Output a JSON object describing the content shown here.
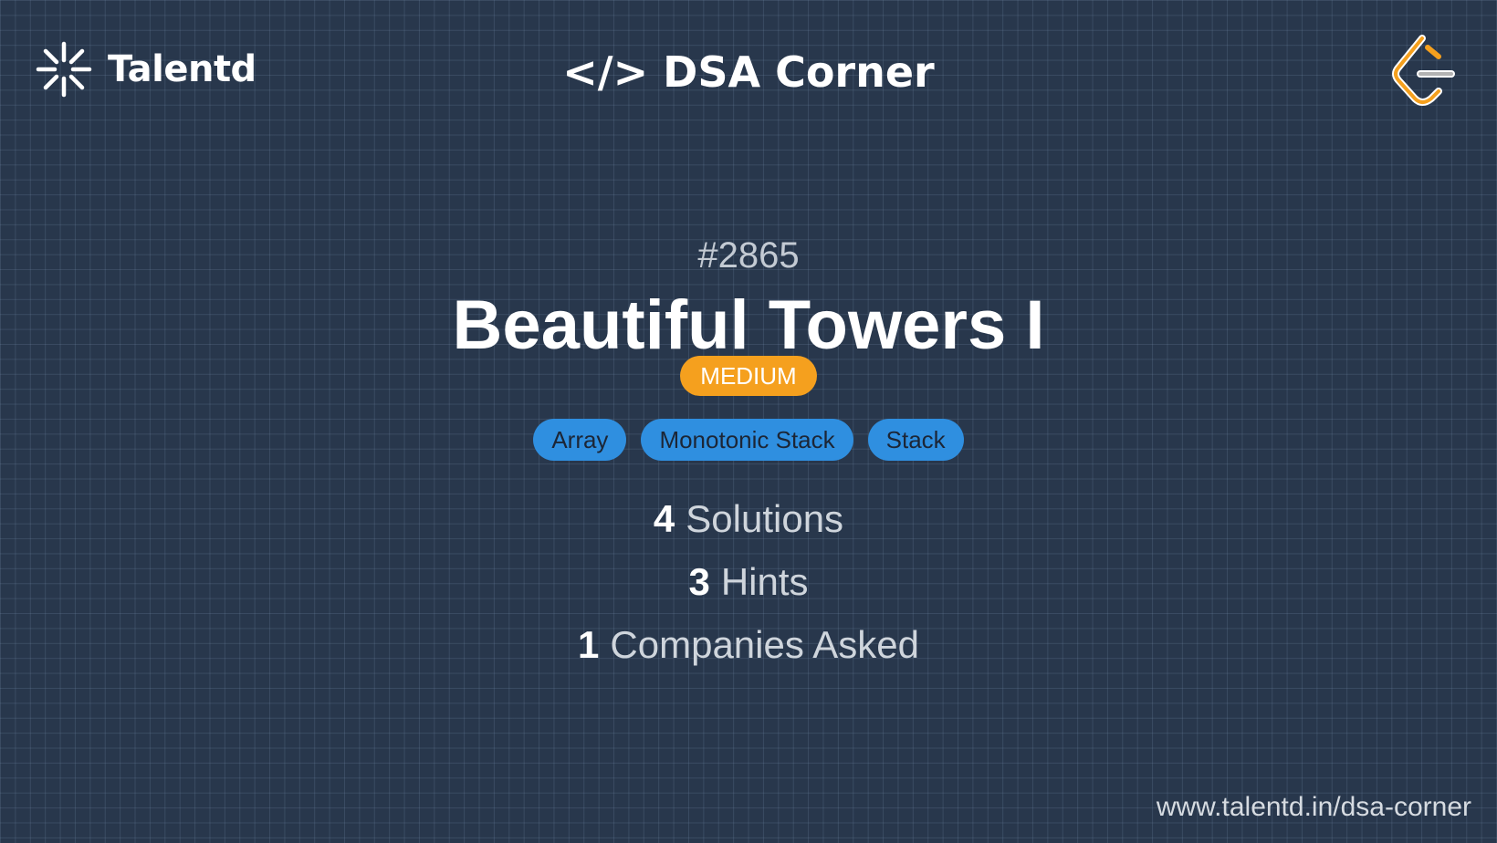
{
  "brand": {
    "name": "Talentd",
    "icon": "asterisk-burst-icon"
  },
  "header": {
    "title": "</> DSA Corner"
  },
  "corner_logo": {
    "icon": "leetcode-logo-icon",
    "colors": {
      "bracket": "#f5a01e",
      "dash": "#b3b3b3",
      "outline": "#ffffff"
    }
  },
  "problem": {
    "number": "#2865",
    "title": "Beautiful Towers I",
    "difficulty": "MEDIUM",
    "tags": [
      "Array",
      "Monotonic Stack",
      "Stack"
    ]
  },
  "stats": {
    "solutions": {
      "count": "4",
      "label": "Solutions"
    },
    "hints": {
      "count": "3",
      "label": "Hints"
    },
    "companies": {
      "count": "1",
      "label": "Companies Asked"
    }
  },
  "footer": {
    "url": "www.talentd.in/dsa-corner"
  },
  "colors": {
    "background": "#28374c",
    "difficulty_badge": "#f5a01e",
    "tag": "#2f8fe0",
    "text_primary": "#ffffff",
    "text_secondary": "#cfd5dc"
  }
}
